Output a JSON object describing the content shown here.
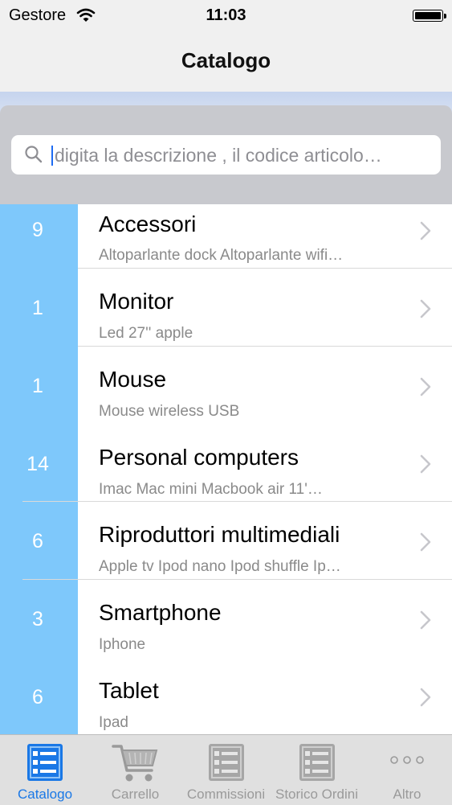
{
  "status": {
    "carrier": "Gestore",
    "time": "11:03"
  },
  "nav": {
    "title": "Catalogo"
  },
  "search": {
    "placeholder": "digita la descrizione , il codice articolo…"
  },
  "categories": [
    {
      "count": "9",
      "title": "Accessori",
      "subtitle": "Altoparlante dock   Altoparlante wifi…"
    },
    {
      "count": "1",
      "title": "Monitor",
      "subtitle": "Led 27'' apple"
    },
    {
      "count": "1",
      "title": "Mouse",
      "subtitle": "Mouse wireless USB"
    },
    {
      "count": "14",
      "title": "Personal computers",
      "subtitle": "Imac   Mac mini   Macbook air 11'…"
    },
    {
      "count": "6",
      "title": "Riproduttori multimediali",
      "subtitle": "Apple tv   Ipod nano   Ipod shuffle   Ip…"
    },
    {
      "count": "3",
      "title": "Smartphone",
      "subtitle": "Iphone"
    },
    {
      "count": "6",
      "title": "Tablet",
      "subtitle": "Ipad"
    }
  ],
  "tabs": [
    {
      "label": "Catalogo",
      "icon": "list-icon",
      "active": true
    },
    {
      "label": "Carrello",
      "icon": "cart-icon",
      "active": false
    },
    {
      "label": "Commissioni",
      "icon": "list-icon",
      "active": false
    },
    {
      "label": "Storico Ordini",
      "icon": "list-icon",
      "active": false
    },
    {
      "label": "Altro",
      "icon": "more-icon",
      "active": false
    }
  ],
  "colors": {
    "accent": "#1a78e6",
    "count_column": "#7ec8fb",
    "inactive_tab": "#9a9a9a"
  }
}
